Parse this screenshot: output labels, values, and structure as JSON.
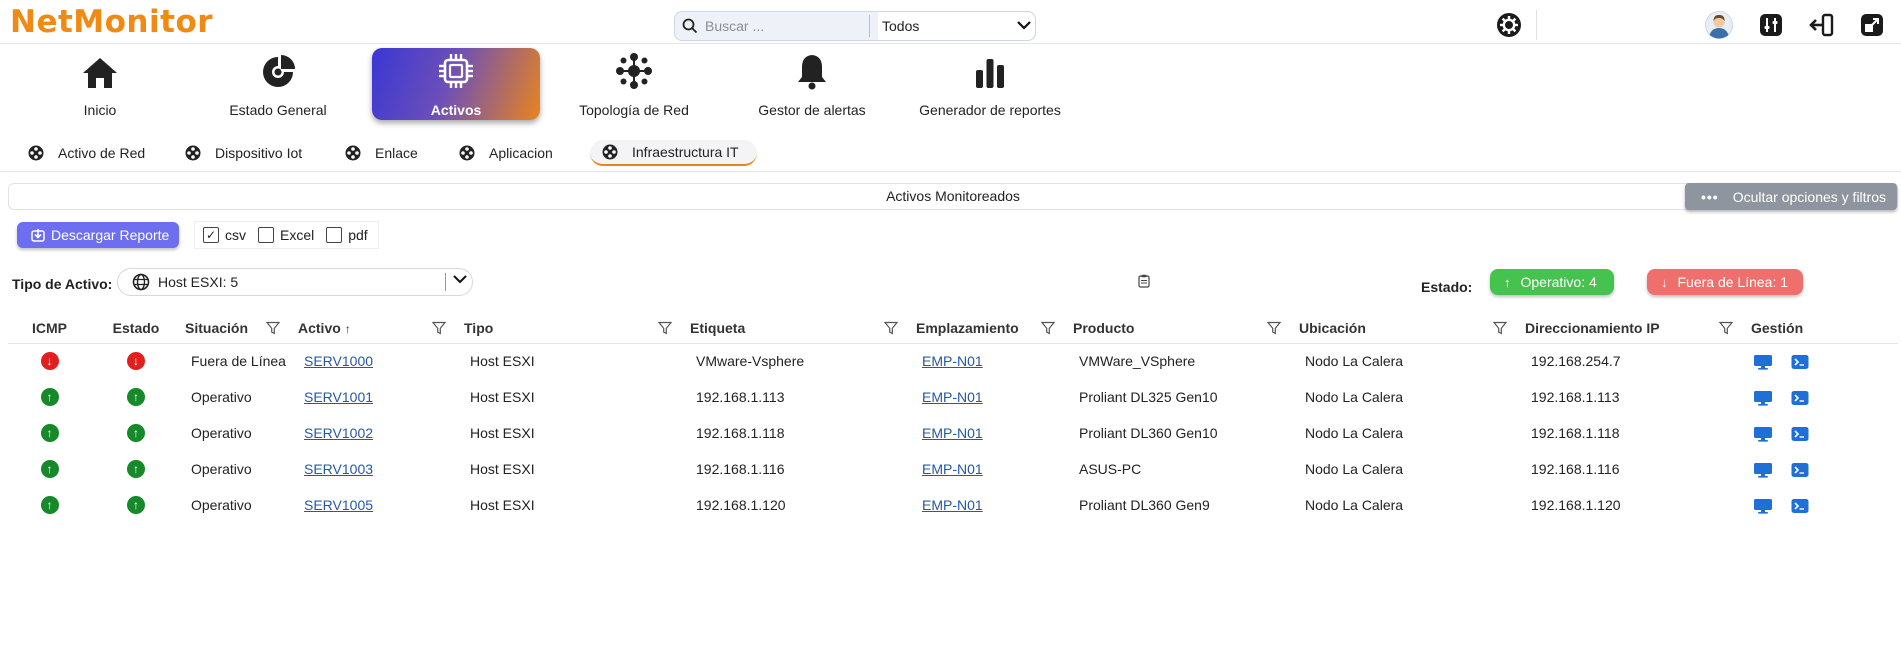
{
  "app": {
    "logo_text": "NetMonitor",
    "accent": "#f08a12"
  },
  "search": {
    "placeholder": "Buscar ...",
    "value": "",
    "scope": "Todos"
  },
  "top_icons": [
    "gear-icon",
    "avatar",
    "equalizer-icon",
    "logout-icon",
    "expand-icon"
  ],
  "main_nav": [
    {
      "label": "Inicio",
      "icon": "home-icon",
      "active": false
    },
    {
      "label": "Estado General",
      "icon": "gauge-icon",
      "active": false
    },
    {
      "label": "Activos",
      "icon": "chip-icon",
      "active": true
    },
    {
      "label": "Topología de Red",
      "icon": "network-icon",
      "active": false
    },
    {
      "label": "Gestor de alertas",
      "icon": "bell-icon",
      "active": false
    },
    {
      "label": "Generador de reportes",
      "icon": "bar-chart-icon",
      "active": false
    }
  ],
  "sub_tabs": [
    {
      "label": "Activo de Red",
      "active": false
    },
    {
      "label": "Dispositivo Iot",
      "active": false
    },
    {
      "label": "Enlace",
      "active": false
    },
    {
      "label": "Aplicacion",
      "active": false
    },
    {
      "label": "Infraestructura IT",
      "active": true
    }
  ],
  "panel": {
    "title": "Activos Monitoreados",
    "hide_button": "Ocultar opciones y filtros"
  },
  "download": {
    "button": "Descargar Reporte",
    "formats": [
      {
        "label": "csv",
        "checked": true
      },
      {
        "label": "Excel",
        "checked": false
      },
      {
        "label": "pdf",
        "checked": false
      }
    ]
  },
  "filters": {
    "type_label": "Tipo de Activo:",
    "type_value": "Host ESXI: 5",
    "estado_label": "Estado:",
    "operativo_badge": "Operativo: 4",
    "fuera_badge": "Fuera de Línea: 1",
    "colors": {
      "ok": "#46c24e",
      "bad": "#ef6f6c"
    }
  },
  "table": {
    "columns": [
      "ICMP",
      "Estado",
      "Situación",
      "Activo",
      "Tipo",
      "Etiqueta",
      "Emplazamiento",
      "Producto",
      "Ubicación",
      "Direccionamiento IP",
      "Gestión"
    ],
    "sort_column": "Activo",
    "sort_dir": "asc",
    "rows": [
      {
        "icmp": "down",
        "estado": "down",
        "situacion": "Fuera de Línea",
        "activo": "SERV1000",
        "tipo": "Host ESXI",
        "etiqueta": "VMware-Vsphere",
        "emplazamiento": "EMP-N01",
        "producto": "VMWare_VSphere",
        "ubicacion": "Nodo La Calera",
        "ip": "192.168.254.7"
      },
      {
        "icmp": "up",
        "estado": "up",
        "situacion": "Operativo",
        "activo": "SERV1001",
        "tipo": "Host ESXI",
        "etiqueta": "192.168.1.113",
        "emplazamiento": "EMP-N01",
        "producto": "Proliant DL325 Gen10",
        "ubicacion": "Nodo La Calera",
        "ip": "192.168.1.113"
      },
      {
        "icmp": "up",
        "estado": "up",
        "situacion": "Operativo",
        "activo": "SERV1002",
        "tipo": "Host ESXI",
        "etiqueta": "192.168.1.118",
        "emplazamiento": "EMP-N01",
        "producto": "Proliant DL360 Gen10",
        "ubicacion": "Nodo La Calera",
        "ip": "192.168.1.118"
      },
      {
        "icmp": "up",
        "estado": "up",
        "situacion": "Operativo",
        "activo": "SERV1003",
        "tipo": "Host ESXI",
        "etiqueta": "192.168.1.116",
        "emplazamiento": "EMP-N01",
        "producto": "ASUS-PC",
        "ubicacion": "Nodo La Calera",
        "ip": "192.168.1.116"
      },
      {
        "icmp": "up",
        "estado": "up",
        "situacion": "Operativo",
        "activo": "SERV1005",
        "tipo": "Host ESXI",
        "etiqueta": "192.168.1.120",
        "emplazamiento": "EMP-N01",
        "producto": "Proliant DL360 Gen9",
        "ubicacion": "Nodo La Calera",
        "ip": "192.168.1.120"
      }
    ]
  }
}
